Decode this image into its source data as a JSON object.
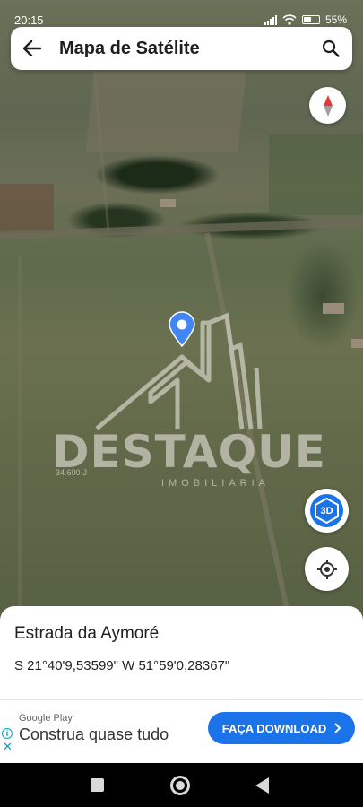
{
  "status_bar": {
    "time": "20:15",
    "battery": "55%"
  },
  "header": {
    "title": "Mapa de Satélite"
  },
  "icons": {
    "back": "arrow-left-icon",
    "search": "search-icon",
    "compass": "compass-icon",
    "pin": "location-pin-icon",
    "locate": "my-location-icon",
    "threed": "3d-cube-icon"
  },
  "map": {
    "watermark": {
      "brand": "DESTAQUE",
      "subtitle": "IMOBILIARIA",
      "creci": "34.600-J"
    },
    "btn_3d": "3D"
  },
  "place": {
    "name": "Estrada da Aymoré",
    "coordinates": "S 21°40'9,53599\" W 51°59'0,28367\""
  },
  "ad": {
    "sponsor": "Google Play",
    "headline": "Construa quase tudo",
    "cta": "FAÇA DOWNLOAD",
    "info": "i",
    "close": "✕"
  },
  "colors": {
    "accent": "#1a73e8",
    "pin": "#4285f4",
    "ad_info": "#00a3c4"
  }
}
